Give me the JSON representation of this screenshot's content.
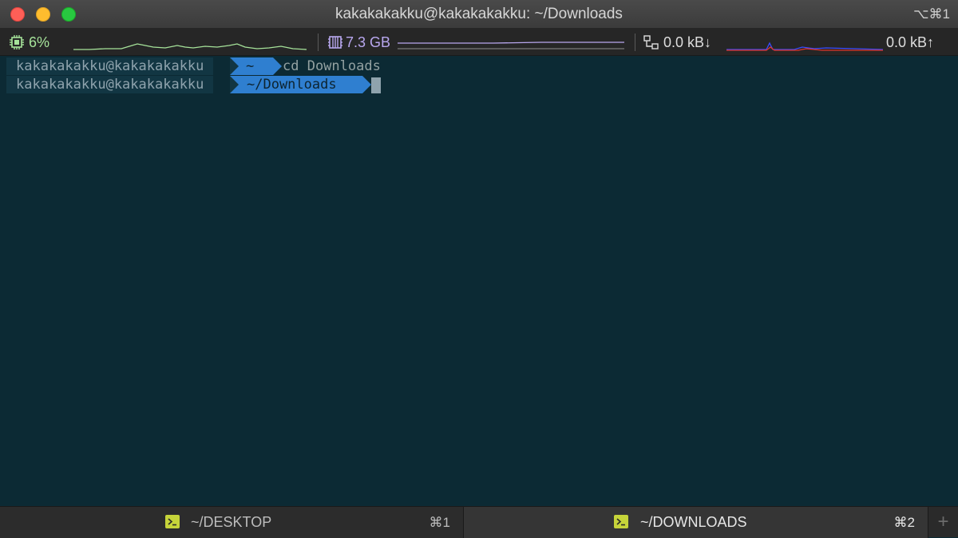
{
  "window": {
    "title": "kakakakakku@kakakakakku: ~/Downloads",
    "shortcut": "⌥⌘1"
  },
  "status": {
    "cpu": {
      "icon": "cpu-chip-icon",
      "value": "6%",
      "color": "#a6e39a"
    },
    "memory": {
      "icon": "memory-icon",
      "value": "7.3 GB",
      "color": "#b8a7ee"
    },
    "network": {
      "icon": "network-icon",
      "download": "0.0 kB↓",
      "upload": "0.0 kB↑",
      "download_color": "#e0352b",
      "upload_color": "#3a4bff"
    }
  },
  "terminal": {
    "lines": [
      {
        "user": "kakakakakku@kakakakakku",
        "dir": "~",
        "command": "cd Downloads"
      },
      {
        "user": "kakakakakku@kakakakakku",
        "dir": "~/Downloads",
        "command": ""
      }
    ],
    "colors": {
      "background": "#0c2a34",
      "user_segment": "#123643",
      "dir_segment": "#2f7fd0",
      "text": "#93a1a1"
    }
  },
  "tabs": [
    {
      "label": "~/DESKTOP",
      "shortcut": "⌘1",
      "icon": "terminal-icon",
      "active": false
    },
    {
      "label": "~/DOWNLOADS",
      "shortcut": "⌘2",
      "icon": "terminal-icon",
      "active": true
    }
  ],
  "new_tab": {
    "icon": "plus-icon",
    "label": "+"
  }
}
